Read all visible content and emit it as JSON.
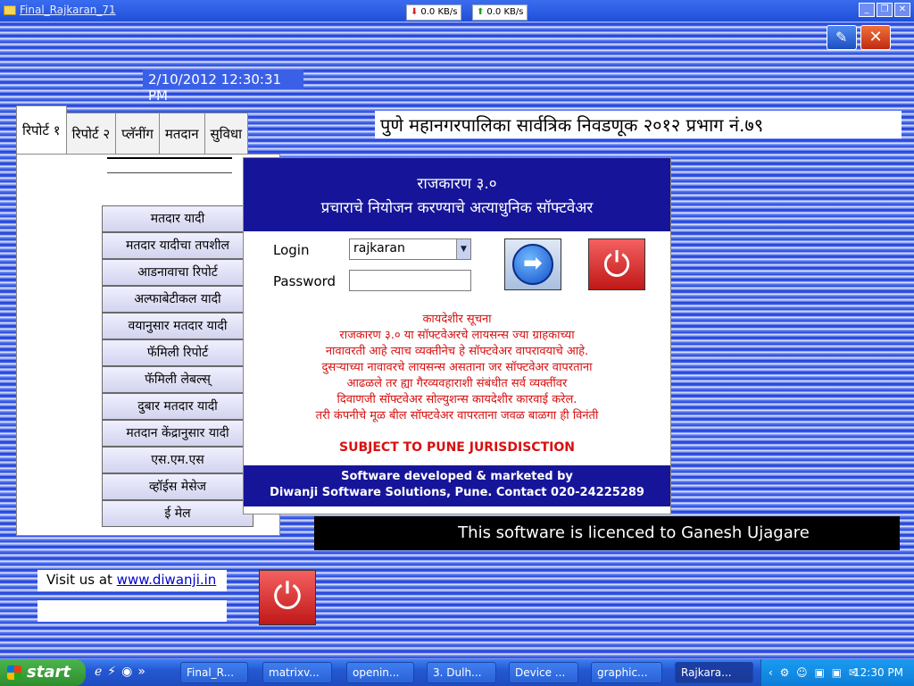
{
  "window": {
    "title": "Final_Rajkaran_71"
  },
  "net_meter": {
    "down": "0.0 KB/s",
    "up": "0.0 KB/s"
  },
  "datetime": "2/10/2012 12:30:31 PM",
  "headline": "पुणे महानगरपालिका सार्वत्रिक निवडणूक २०१२ प्रभाग नं.७९",
  "tabs": [
    "रिपोर्ट १",
    "रिपोर्ट २",
    "प्लॅनींग",
    "मतदान",
    "सुविधा"
  ],
  "menu": [
    "मतदार यादी",
    "मतदार यादीचा तपशील",
    "आडनावाचा रिपोर्ट",
    "अल्फाबेटीकल यादी",
    "वयानुसार मतदार यादी",
    "फॅमिली रिपोर्ट",
    "फॅमिली लेबल्स्",
    "दुबार मतदार यादी",
    "मतदान केंद्रानुसार यादी",
    "एस.एम.एस",
    "व्हॉईस मेसेज",
    "ई मेल"
  ],
  "dialog": {
    "app_name": "राजकारण ३.०",
    "tagline": "प्रचाराचे नियोजन करण्याचे अत्याधुनिक सॉफ्टवेअर",
    "login_label": "Login",
    "login_value": "rajkaran",
    "password_label": "Password",
    "notice_lines": [
      "कायदेशीर सूचना",
      "राजकारण ३.० या सॉफ्टवेअरचे लायसन्स ज्या ग्राहकाच्या",
      "नावावरती आहे त्याच व्यक्तीनेच हे सॉफ्टवेअर वापरावयाचे आहे.",
      "दुसऱ्याच्या नावावरचे लायसन्स असताना जर सॉफ्टवेअर वापरताना",
      "आढळले तर ह्या गैरव्यवहाराशी संबंधीत सर्व व्यक्तींवर",
      "दिवाणजी सॉफ्टवेअर सोल्युशन्स कायदेशीर कारवाई करेल.",
      "तरी कंपनीचे मूळ बील सॉफ्टवेअर वापरताना जवळ बाळगा ही विनंती"
    ],
    "jurisdiction": "SUBJECT TO PUNE JURISDISCTION",
    "footer_line1": "Software developed & marketed by",
    "footer_line2": "Diwanji Software Solutions, Pune.  Contact 020-24225289"
  },
  "licence": "This software is licenced to Ganesh Ujagare",
  "visit": {
    "prefix": "Visit us at ",
    "link": "www.diwanji.in"
  },
  "taskbar": {
    "start": "start",
    "tasks": [
      "Final_R...",
      "matrixv...",
      "openin...",
      "3. Dulh...",
      "Device ...",
      "graphic...",
      "Rajkara..."
    ],
    "clock": "12:30 PM"
  }
}
